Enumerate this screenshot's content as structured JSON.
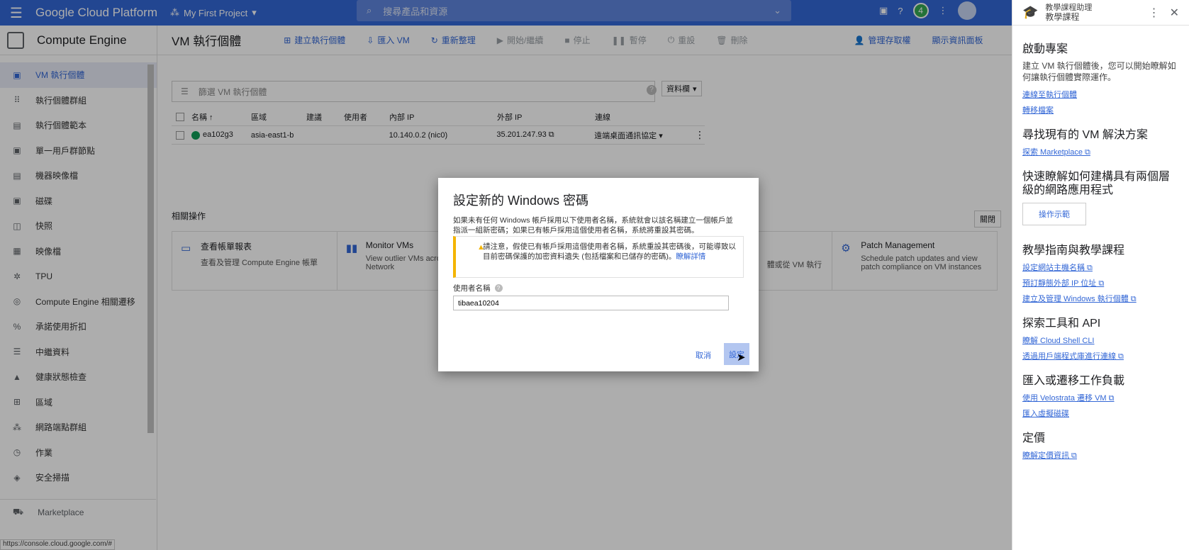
{
  "topbar": {
    "brand": "Google Cloud Platform",
    "project": "My First Project",
    "search_placeholder": "搜尋產品和資源",
    "notifications": "4"
  },
  "sidebar": {
    "product": "Compute Engine",
    "items": [
      {
        "label": "VM 執行個體",
        "icon": "▣",
        "active": true
      },
      {
        "label": "執行個體群組",
        "icon": "⠿"
      },
      {
        "label": "執行個體範本",
        "icon": "▤"
      },
      {
        "label": "單一用戶群節點",
        "icon": "▣"
      },
      {
        "label": "機器映像檔",
        "icon": "▤"
      },
      {
        "label": "磁碟",
        "icon": "▣"
      },
      {
        "label": "快照",
        "icon": "◫"
      },
      {
        "label": "映像檔",
        "icon": "▦"
      },
      {
        "label": "TPU",
        "icon": "✲"
      },
      {
        "label": "Compute Engine 相關遷移",
        "icon": "◎"
      },
      {
        "label": "承諾使用折扣",
        "icon": "%"
      },
      {
        "label": "中繼資料",
        "icon": "☰"
      },
      {
        "label": "健康狀態檢查",
        "icon": "▲"
      },
      {
        "label": "區域",
        "icon": "⊞"
      },
      {
        "label": "網路端點群組",
        "icon": "⁂"
      },
      {
        "label": "作業",
        "icon": "◷"
      },
      {
        "label": "安全掃描",
        "icon": "◈"
      }
    ],
    "marketplace": "Marketplace",
    "url": "https://console.cloud.google.com/#"
  },
  "toolbar": {
    "title": "VM 執行個體",
    "create": "建立執行個體",
    "import": "匯入 VM",
    "refresh": "重新整理",
    "start": "開始/繼續",
    "stop": "停止",
    "suspend": "暫停",
    "reset": "重設",
    "delete": "刪除",
    "manage_access": "管理存取權",
    "show_info": "顯示資訊面板"
  },
  "filter": {
    "placeholder": "篩選 VM 執行個體",
    "columns": "資料欄"
  },
  "table": {
    "headers": [
      "名稱",
      "區域",
      "建議",
      "使用者",
      "內部 IP",
      "外部 IP",
      "連線"
    ],
    "rows": [
      {
        "name": "ea102g3",
        "zone": "asia-east1-b",
        "recommendation": "",
        "user": "",
        "internal_ip": "10.140.0.2 (nic0)",
        "external_ip": "35.201.247.93",
        "connect": "遠端桌面通訊協定"
      }
    ]
  },
  "related": {
    "title": "相關操作",
    "close": "關閉",
    "cards": [
      {
        "title": "查看帳單報表",
        "desc": "查看及管理 Compute Engine 帳單"
      },
      {
        "title": "Monitor VMs",
        "desc": "View outlier VMs across CPU and Network"
      },
      {
        "title": "",
        "desc": ""
      },
      {
        "title": "",
        "desc": "體或從 VM 執行"
      },
      {
        "title": "Patch Management",
        "desc": "Schedule patch updates and view patch compliance on VM instances"
      }
    ]
  },
  "rpanel": {
    "title_line1": "教學課程助理",
    "title_line2": "教學課程",
    "s1_title": "啟動專案",
    "s1_desc": "建立 VM 執行個體後，您可以開始瞭解如何讓執行個體實際運作。",
    "s1_links": [
      "連線至執行個體",
      "轉移檔案"
    ],
    "s2_title": "尋找現有的 VM 解決方案",
    "s2_links": [
      "探索 Marketplace ⧉"
    ],
    "s3_title": "快速瞭解如何建構具有兩個層級的網路應用程式",
    "s3_button": "操作示範",
    "s4_title": "教學指南與教學課程",
    "s4_links": [
      "設定網站主機名稱 ⧉",
      "預訂靜態外部 IP 位址 ⧉",
      "建立及管理 Windows 執行個體 ⧉"
    ],
    "s5_title": "探索工具和 API",
    "s5_links": [
      "瞭解 Cloud Shell CLI",
      "透過用戶端程式庫進行連線 ⧉"
    ],
    "s6_title": "匯入或遷移工作負載",
    "s6_links": [
      "使用 Velostrata 遷移 VM ⧉",
      "匯入虛擬磁碟"
    ],
    "s7_title": "定價",
    "s7_links": [
      "瞭解定價資訊 ⧉"
    ]
  },
  "dialog": {
    "title": "設定新的 Windows 密碼",
    "desc": "如果未有任何 Windows 帳戶採用以下使用者名稱，系統就會以該名稱建立一個帳戶並指派一組新密碼；如果已有帳戶採用這個使用者名稱，系統將重設其密碼。",
    "warning": "請注意，假使已有帳戶採用這個使用者名稱，系統重設其密碼後，可能導致以目前密碼保護的加密資料遺失 (包括檔案和已儲存的密碼)。",
    "warning_link": "瞭解詳情",
    "username_label": "使用者名稱",
    "username_value": "tibaea10204",
    "cancel": "取消",
    "set": "設定"
  }
}
